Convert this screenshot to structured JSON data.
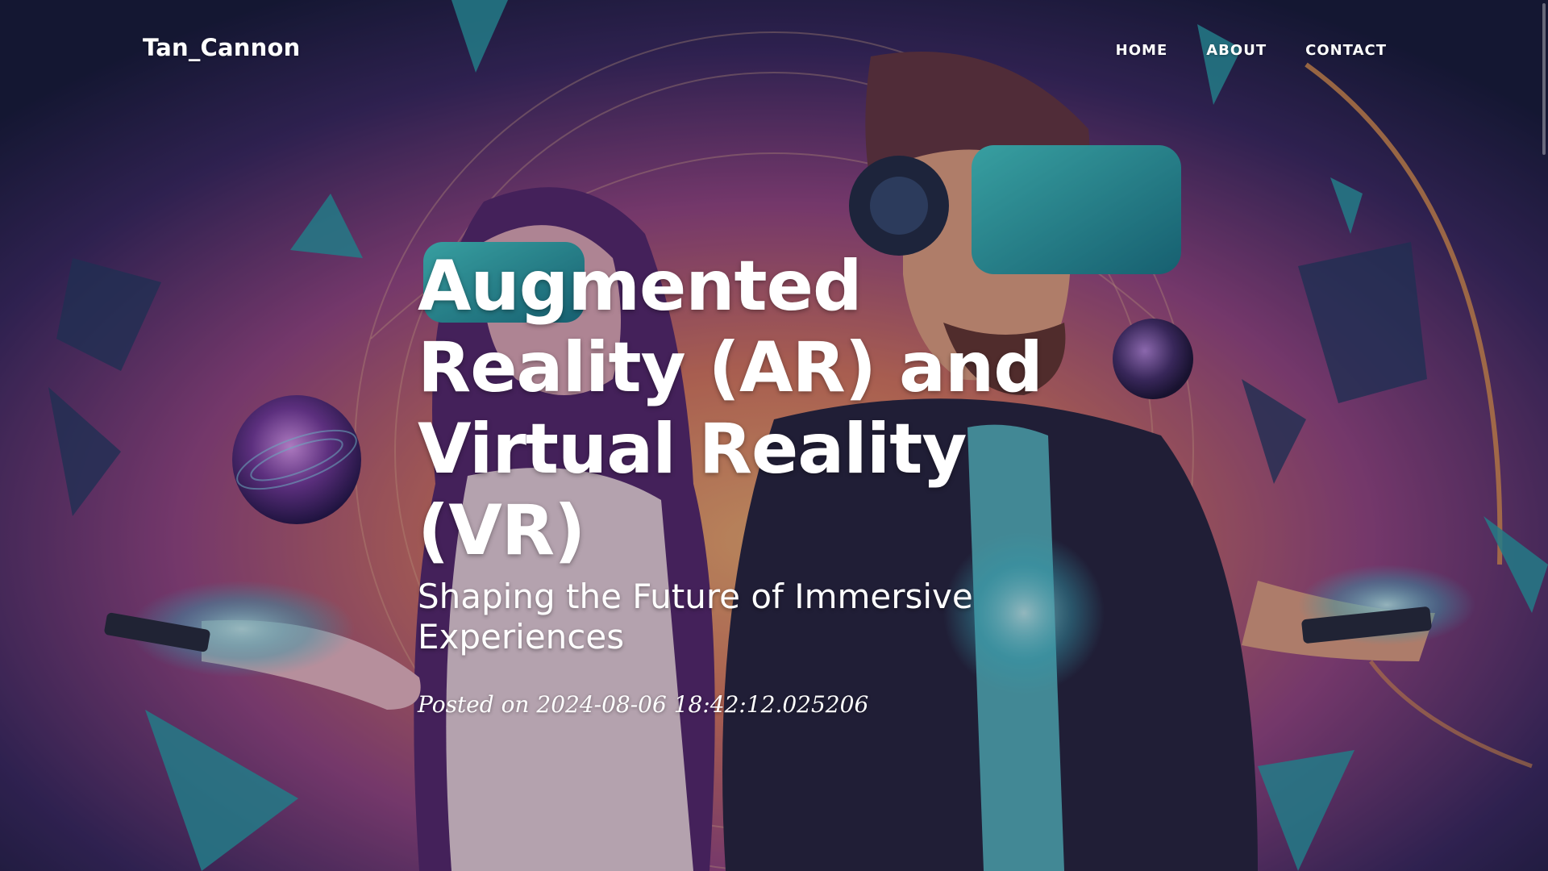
{
  "navbar": {
    "brand": "Tan_Cannon",
    "links": [
      {
        "label": "HOME"
      },
      {
        "label": "ABOUT"
      },
      {
        "label": "CONTACT"
      }
    ]
  },
  "post": {
    "title": "Augmented Reality (AR) and Virtual Reality (VR)",
    "subtitle": "Shaping the Future of Immersive Experiences",
    "meta_prefix": "Posted on",
    "date": "2024-08-06 18:42:12.025206"
  },
  "hero_image": {
    "description_icon": "vr-headset-illustration",
    "colors": {
      "deep_navy": "#1c2247",
      "purple": "#7a3a8a",
      "magenta": "#c84a8e",
      "orange": "#e98a5a",
      "teal": "#2bb8c2"
    }
  }
}
